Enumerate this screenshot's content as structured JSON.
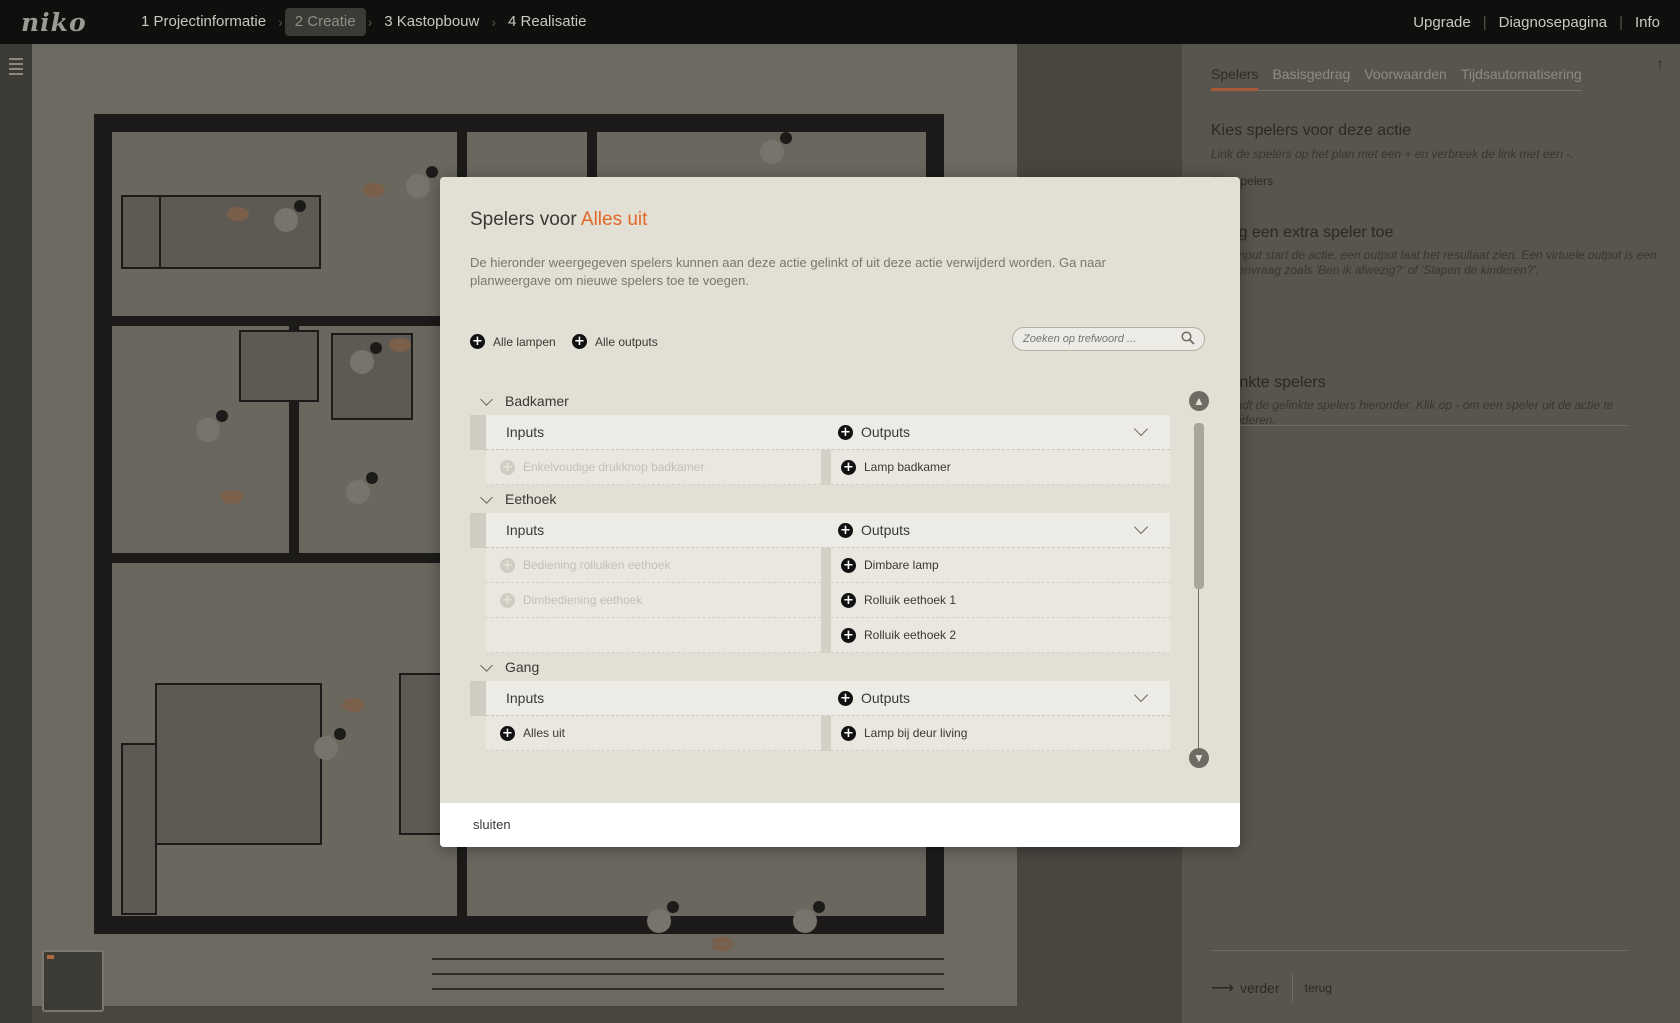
{
  "topbar": {
    "logo": "niko",
    "steps": [
      "1 Projectinformatie",
      "2 Creatie",
      "3 Kastopbouw",
      "4 Realisatie"
    ],
    "right_links": [
      "Upgrade",
      "Diagnosepagina",
      "Info"
    ]
  },
  "right_panel": {
    "tabs": [
      "Spelers",
      "Basisgedrag",
      "Voorwaarden",
      "Tijdsautomatisering"
    ],
    "choose_title": "Kies spelers voor deze actie",
    "choose_desc": "Link de spelers op het plan met een + en verbreek de link met een -.",
    "all_players": "Alle spelers",
    "extra_title": "Voeg een extra speler toe",
    "extra_desc": "Een input start de actie, een output laat het resultaat zien. Een virtuele output is een ja-neenvraag zoals 'Ben ik afwezig?' of 'Slapen de kinderen?'.",
    "linked_title": "Gelinkte spelers",
    "linked_desc": "Je vindt de gelinkte spelers hieronder. Klik op - om een speler uit de actie te verwijderen.",
    "next": "verder",
    "back": "terug"
  },
  "modal": {
    "title_prefix": "Spelers voor",
    "title_action": "Alles uit",
    "description": "De hieronder weergegeven spelers kunnen aan deze actie gelinkt of uit deze actie verwijderd worden. Ga naar planweergave om nieuwe spelers toe te voegen.",
    "all_lamps": "Alle lampen",
    "all_outputs": "Alle outputs",
    "search_placeholder": "Zoeken op trefwoord ...",
    "inputs_label": "Inputs",
    "outputs_label": "Outputs",
    "groups": [
      {
        "name": "Badkamer",
        "rows": [
          {
            "input": "Enkelvoudige drukknop badkamer",
            "output": "Lamp badkamer"
          }
        ]
      },
      {
        "name": "Eethoek",
        "rows": [
          {
            "input": "Bediening rolluiken eethoek",
            "output": "Dimbare lamp"
          },
          {
            "input": "Dimbediening eethoek",
            "output": "Rolluik eethoek 1"
          },
          {
            "input": "",
            "output": "Rolluik eethoek 2"
          }
        ]
      },
      {
        "name": "Gang",
        "rows": [
          {
            "input": "Alles uit",
            "output": "Lamp bij deur living"
          }
        ]
      }
    ],
    "close": "sluiten"
  }
}
